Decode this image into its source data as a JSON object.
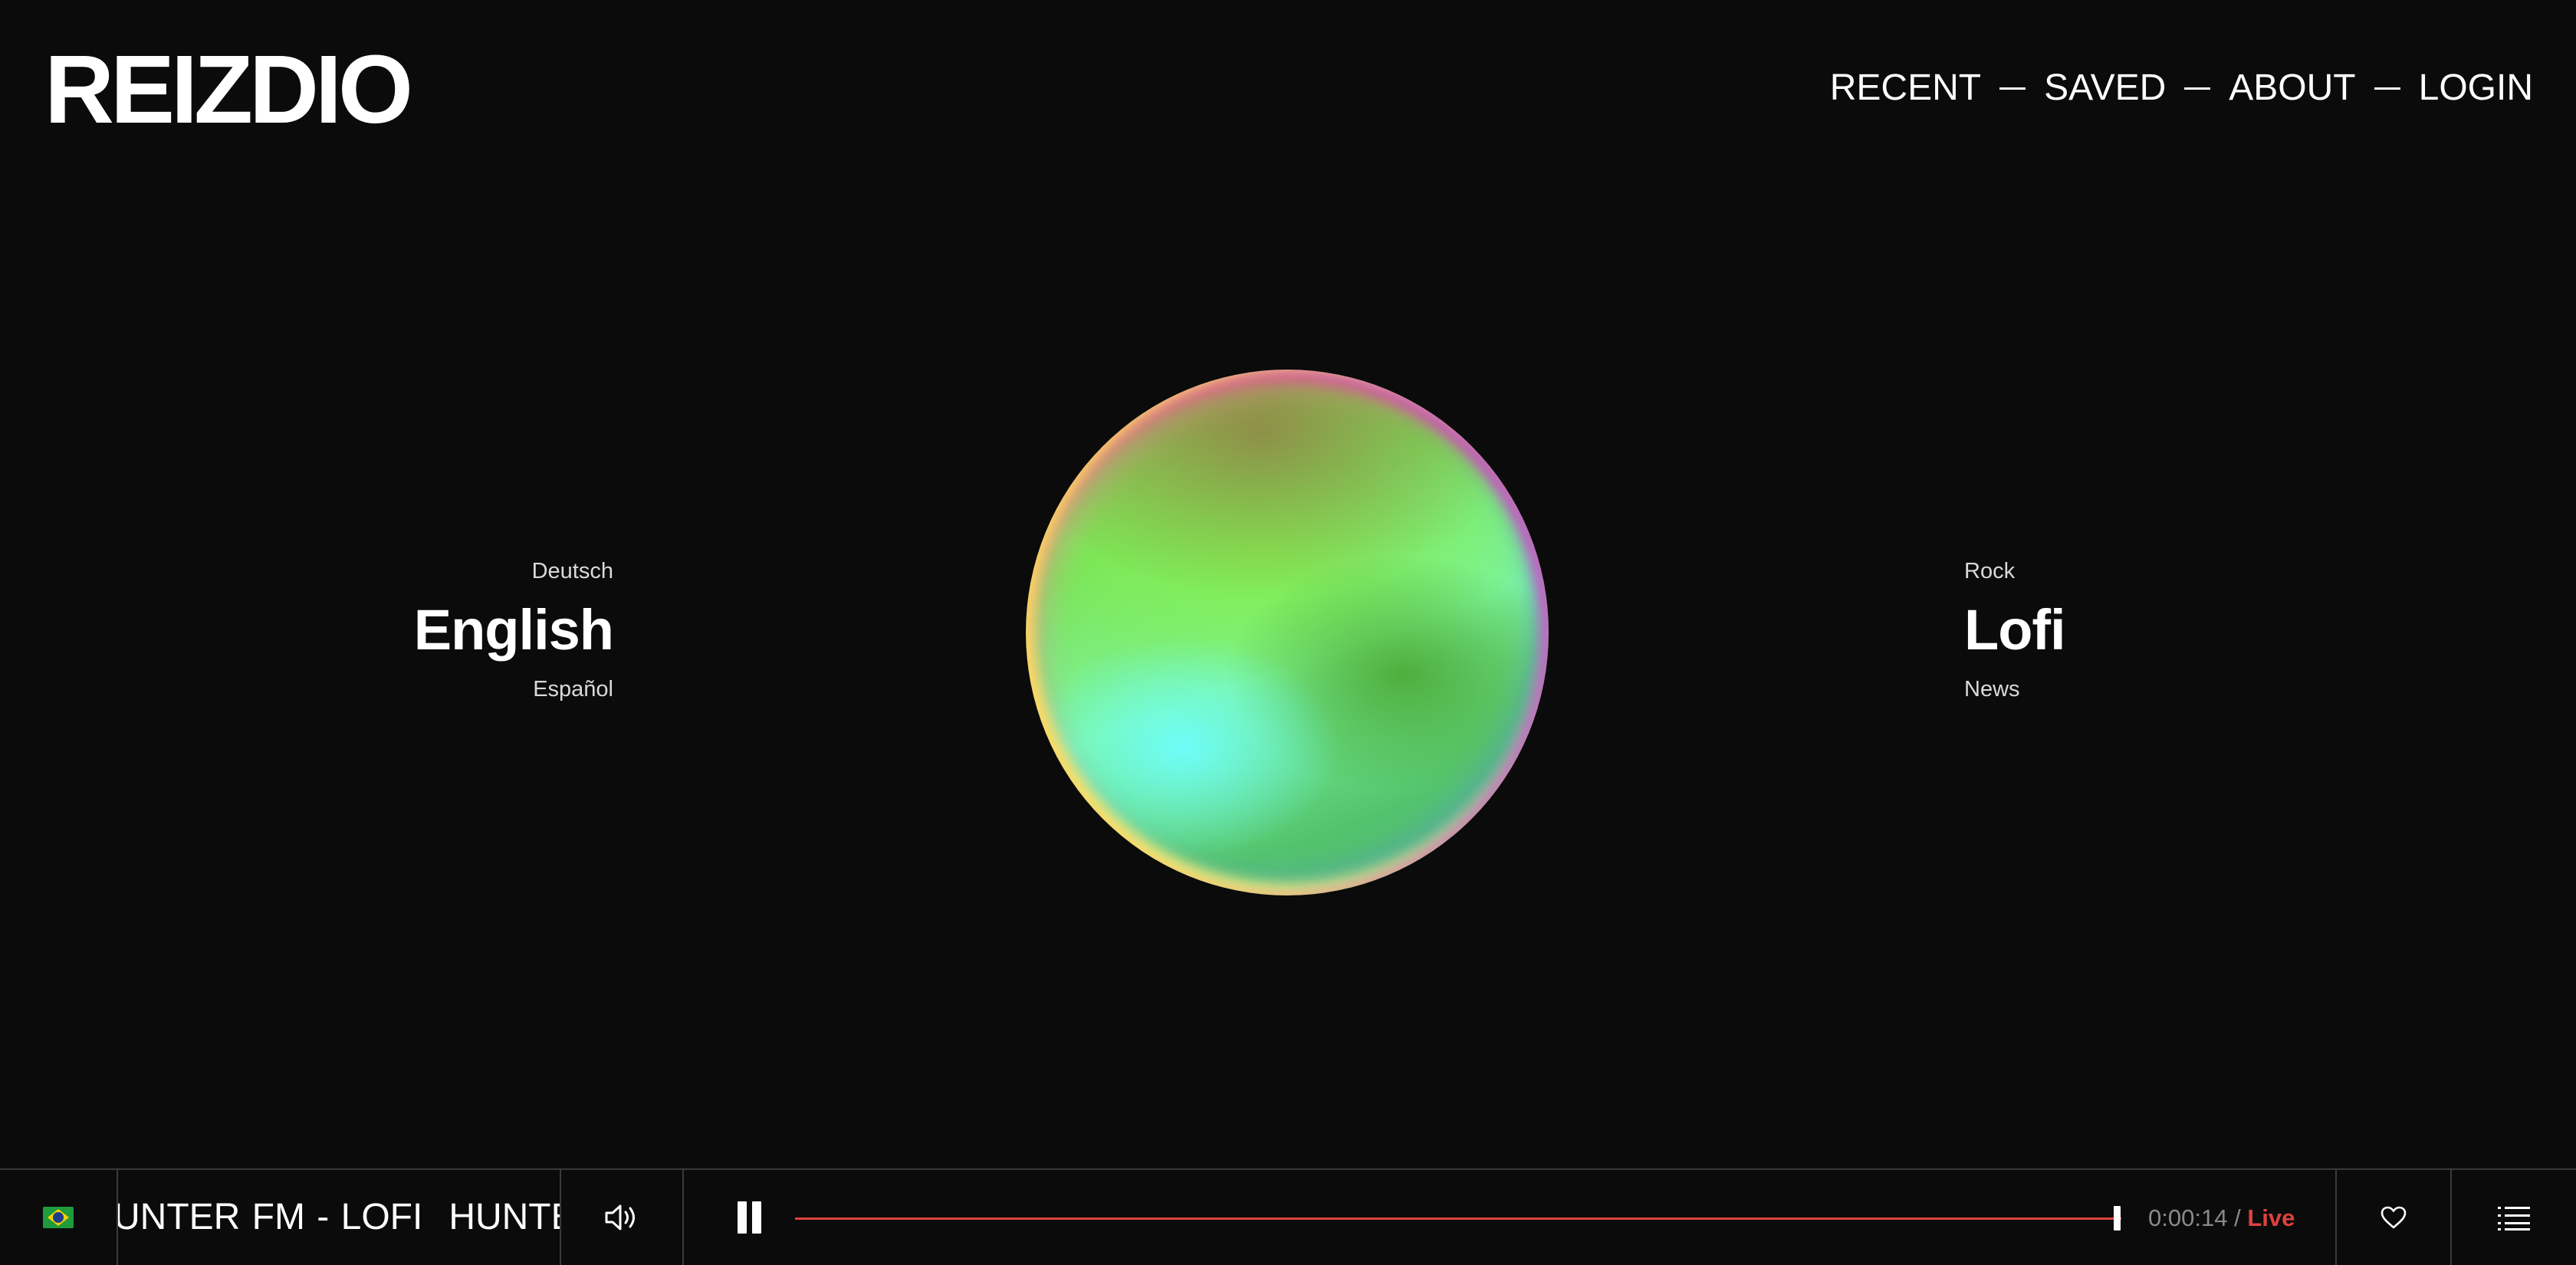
{
  "app": {
    "logo": "REIZDIO"
  },
  "nav": {
    "items": [
      {
        "label": "RECENT"
      },
      {
        "label": "SAVED"
      },
      {
        "label": "ABOUT"
      },
      {
        "label": "LOGIN"
      }
    ]
  },
  "language": {
    "previous": "Deutsch",
    "selected": "English",
    "next": "Español"
  },
  "genre": {
    "previous": "Rock",
    "selected": "Lofi",
    "next": "News"
  },
  "player": {
    "flag_icon": "brazil-flag-icon",
    "ticker": [
      "UNTER FM - LOFI",
      "HUNTER"
    ],
    "elapsed": "0:00:14",
    "separator": "/",
    "live_label": "Live",
    "progress": 1.0,
    "colors": {
      "accent": "#e0413e",
      "background": "#0b0b0b",
      "divider": "#3a3a3a"
    }
  }
}
